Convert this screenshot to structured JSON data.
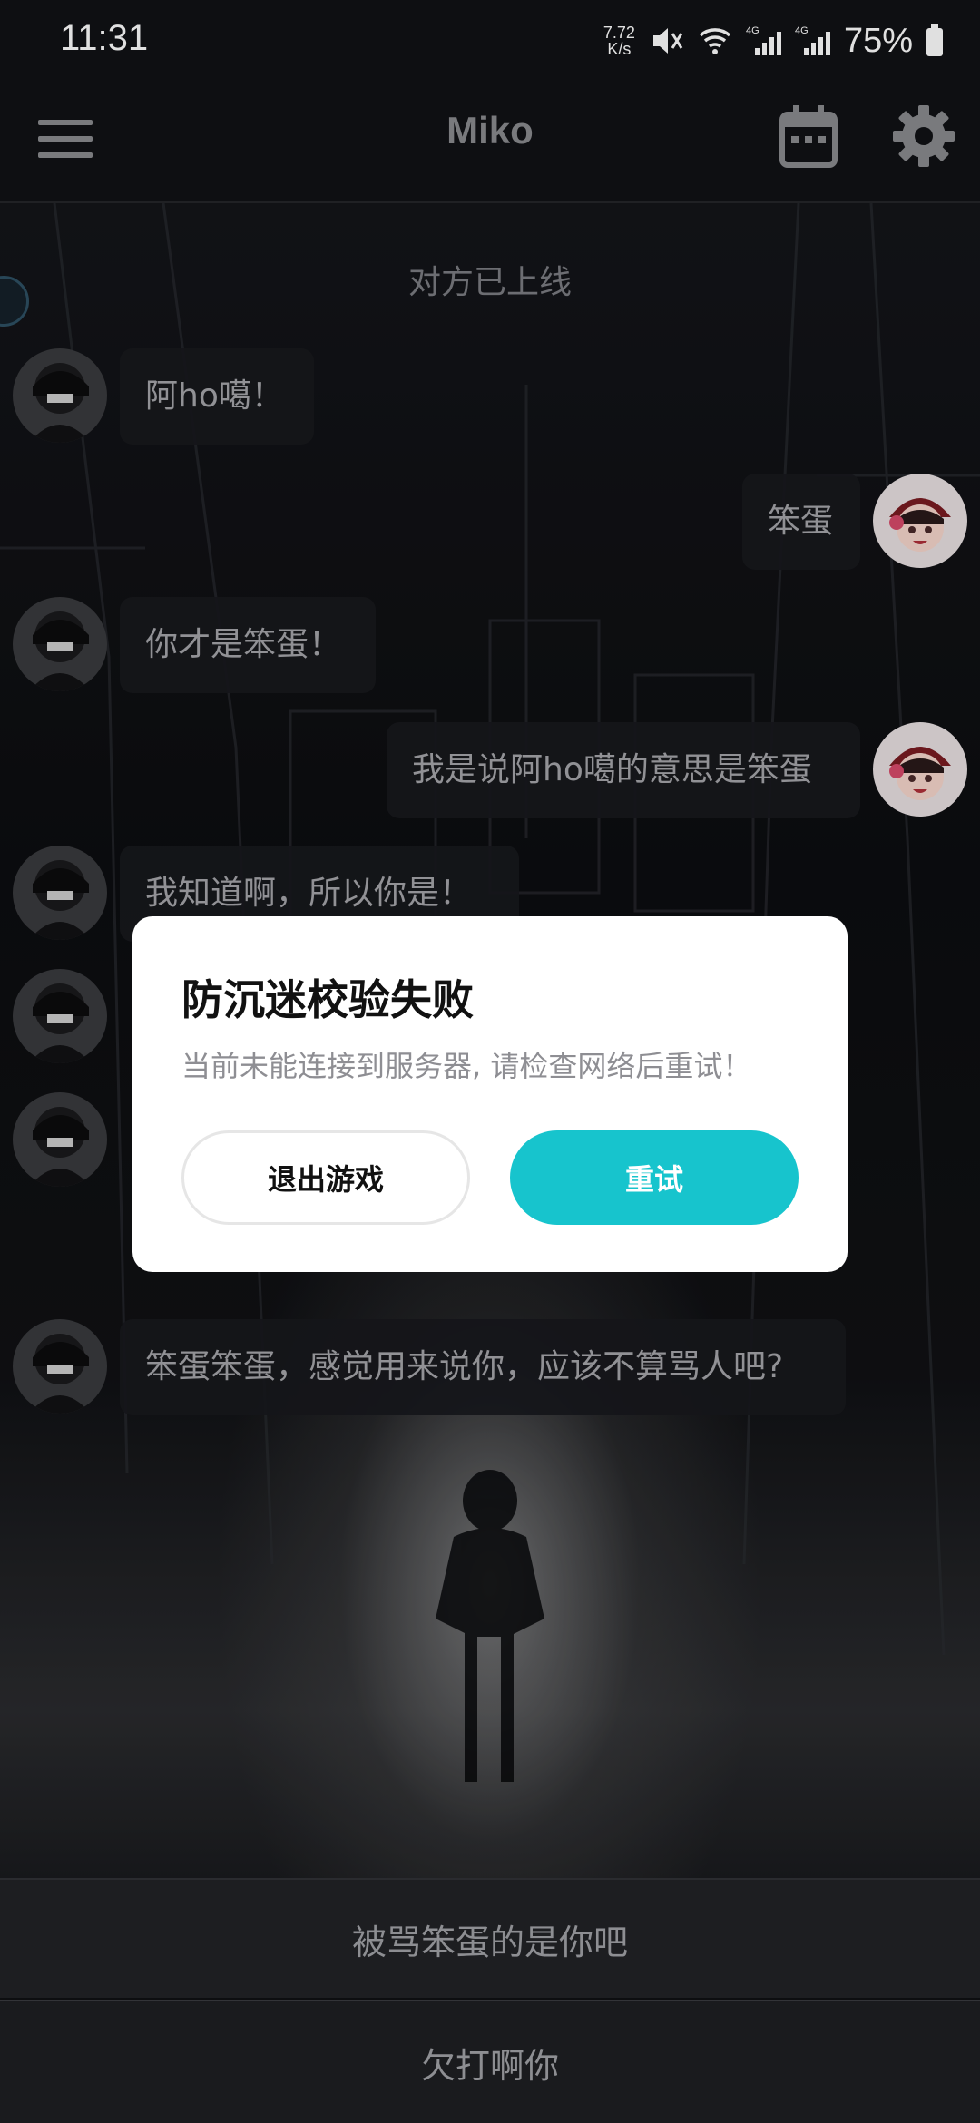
{
  "status_bar": {
    "time": "11:31",
    "net_speed_value": "7.72",
    "net_speed_unit": "K/s",
    "battery": "75%",
    "icons": [
      "mute-icon",
      "wifi-icon",
      "signal-4g-icon",
      "signal-4g-icon",
      "battery-icon"
    ]
  },
  "appbar": {
    "title": "Miko",
    "icons": [
      "menu-icon",
      "calendar-icon",
      "gear-icon"
    ]
  },
  "chat": {
    "system_message": "对方已上线",
    "messages": [
      {
        "side": "left",
        "text": "阿ho噶！"
      },
      {
        "side": "right",
        "text": "笨蛋"
      },
      {
        "side": "left",
        "text": "你才是笨蛋！"
      },
      {
        "side": "right",
        "text": "我是说阿ho噶的意思是笨蛋"
      },
      {
        "side": "left",
        "text": "我知道啊，所以你是！"
      },
      {
        "side": "left",
        "text": "笨蛋笨蛋，感觉用来说你，应该不算骂人吧?"
      }
    ]
  },
  "dialog": {
    "title": "防沉迷校验失败",
    "message": "当前未能连接到服务器, 请检查网络后重试！",
    "exit_label": "退出游戏",
    "retry_label": "重试"
  },
  "replies": [
    "被骂笨蛋的是你吧",
    "欠打啊你"
  ],
  "colors": {
    "accent": "#17c4cd",
    "background": "#0f1013",
    "bubble": "#18191d",
    "dialog_bg": "#ffffff"
  }
}
